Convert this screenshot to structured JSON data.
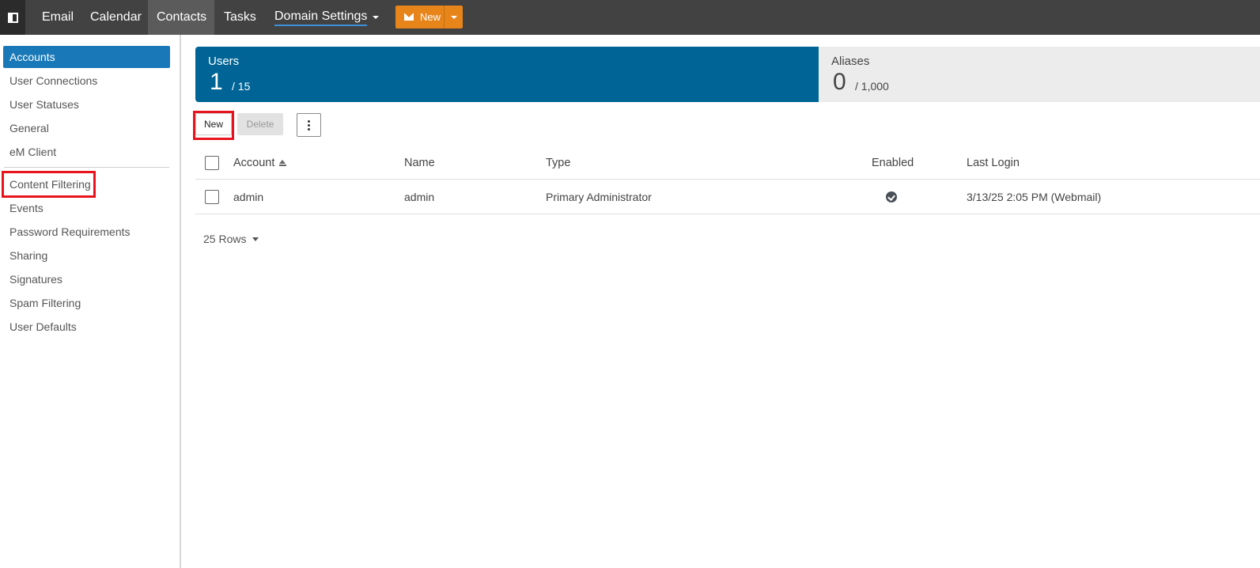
{
  "topbar": {
    "tabs": [
      {
        "label": "Email"
      },
      {
        "label": "Calendar"
      },
      {
        "label": "Contacts"
      },
      {
        "label": "Tasks"
      },
      {
        "label": "Domain Settings"
      }
    ],
    "active_tab": "Contacts",
    "new_button_label": "New",
    "accent_color": "#e7851b"
  },
  "sidebar": {
    "items": [
      {
        "label": "Accounts"
      },
      {
        "label": "User Connections"
      },
      {
        "label": "User Statuses"
      },
      {
        "label": "General"
      },
      {
        "label": "eM Client"
      },
      {
        "label": "Content Filtering"
      },
      {
        "label": "Events"
      },
      {
        "label": "Password Requirements"
      },
      {
        "label": "Sharing"
      },
      {
        "label": "Signatures"
      },
      {
        "label": "Spam Filtering"
      },
      {
        "label": "User Defaults"
      }
    ],
    "active_item": "Accounts",
    "active_color": "#1979b8"
  },
  "stats": {
    "users": {
      "title": "Users",
      "count": "1",
      "limit": "/ 15"
    },
    "aliases": {
      "title": "Aliases",
      "count": "0",
      "limit": "/ 1,000"
    }
  },
  "toolbar": {
    "new_label": "New",
    "delete_label": "Delete"
  },
  "table": {
    "columns": [
      "Account",
      "Name",
      "Type",
      "Enabled",
      "Last Login"
    ],
    "rows": [
      {
        "account": "admin",
        "name": "admin",
        "type": "Primary Administrator",
        "enabled": true,
        "last_login": "3/13/25 2:05 PM (Webmail)"
      }
    ]
  },
  "pagination": {
    "rows_label": "25 Rows"
  }
}
